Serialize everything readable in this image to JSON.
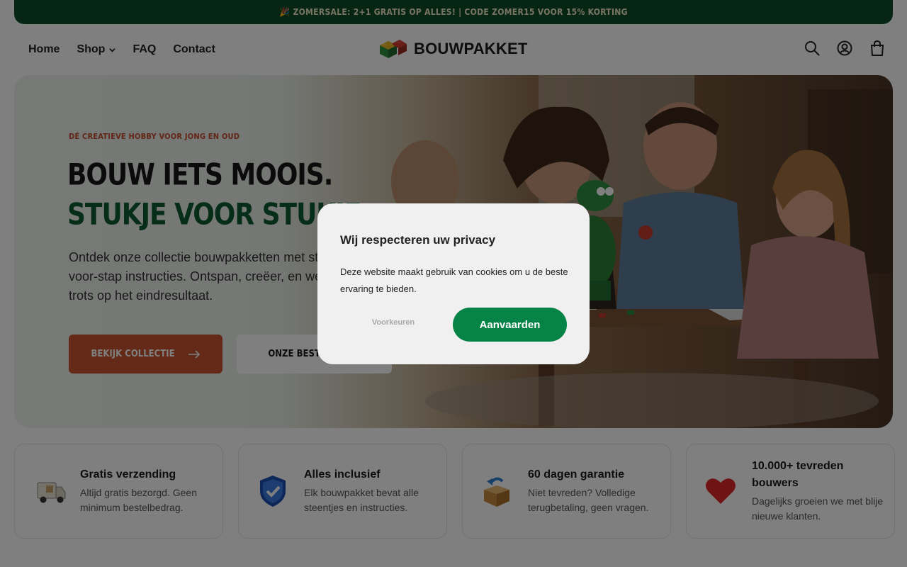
{
  "announcement": {
    "text": "🎉 ZOMERSALE: 2+1 GRATIS OP ALLES! | CODE ZOMER15 VOOR 15% KORTING"
  },
  "nav": {
    "items": [
      {
        "label": "Home"
      },
      {
        "label": "Shop"
      },
      {
        "label": "FAQ"
      },
      {
        "label": "Contact"
      }
    ]
  },
  "logo": {
    "text": "BOUWPAKKET"
  },
  "header_icons": [
    "search-icon",
    "account-icon",
    "cart-icon"
  ],
  "hero": {
    "eyebrow": "DÉ CREATIEVE HOBBY VOOR JONG EN OUD",
    "title_line1": "BOUW IETS MOOIS.",
    "title_line2": "STUKJE VOOR STUKJE.",
    "text": "Ontdek onze collectie bouwpakketten met stap-voor-stap instructies. Ontspan, creëer, en wees trots op het eindresultaat.",
    "primary_button": "BEKIJK COLLECTIE",
    "secondary_button": "ONZE BESTSELLERS"
  },
  "features": [
    {
      "icon": "truck-icon",
      "title": "Gratis verzending",
      "text": "Altijd gratis bezorgd. Geen minimum bestelbedrag."
    },
    {
      "icon": "shield-check-icon",
      "title": "Alles inclusief",
      "text": "Elk bouwpakket bevat alle steentjes en instructies."
    },
    {
      "icon": "return-box-icon",
      "title": "60 dagen garantie",
      "text": "Niet tevreden? Volledige terugbetaling, geen vragen."
    },
    {
      "icon": "heart-icon",
      "title": "10.000+ tevreden bouwers",
      "text": "Dagelijks groeien we met blije nieuwe klanten."
    }
  ],
  "cookie_modal": {
    "title": "Wij respecteren uw privacy",
    "text": "Deze website maakt gebruik van cookies om u de beste ervaring te bieden.",
    "preferences_button": "Voorkeuren",
    "accept_button": "Aanvaarden"
  },
  "colors": {
    "brand_green": "#0d4d26",
    "accent_orange": "#c9532f",
    "accept_green": "#068447"
  }
}
